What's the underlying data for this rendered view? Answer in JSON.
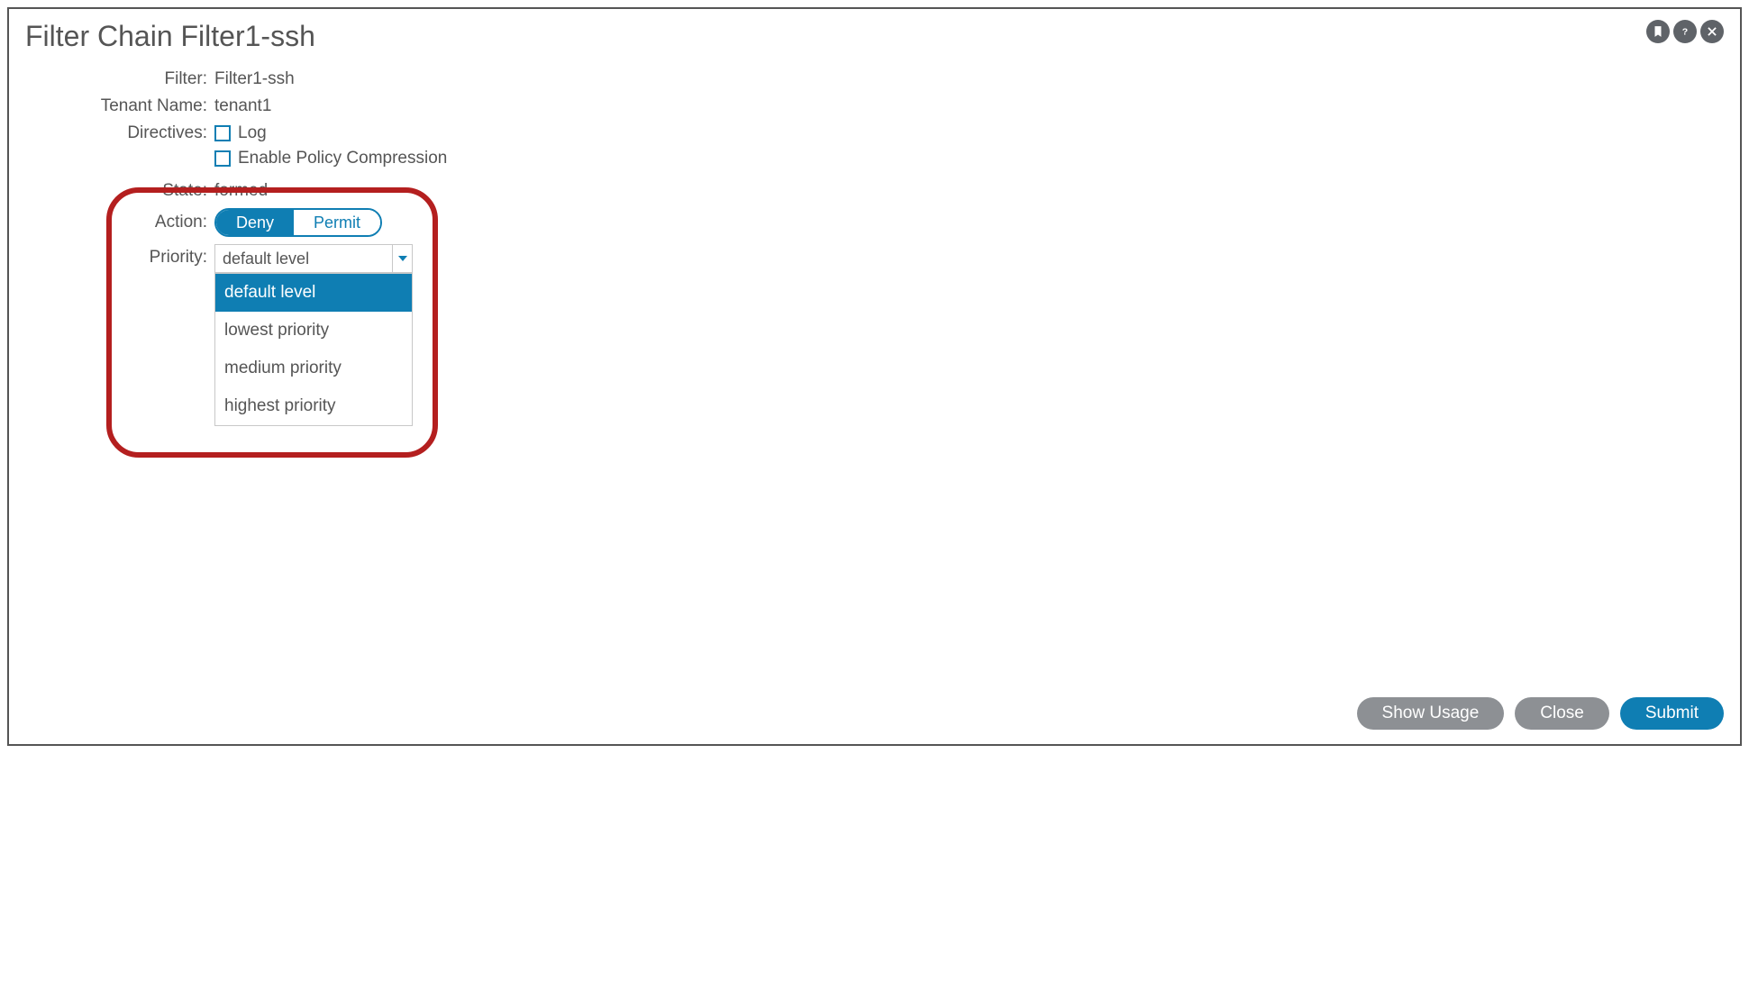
{
  "header": {
    "title_prefix": "Filter Chain ",
    "title_name": "Filter1-ssh"
  },
  "form": {
    "labels": {
      "filter": "Filter:",
      "tenant": "Tenant Name:",
      "directives": "Directives:",
      "state": "State:",
      "action": "Action:",
      "priority": "Priority:"
    },
    "values": {
      "filter": "Filter1-ssh",
      "tenant": "tenant1",
      "directive_log": "Log",
      "directive_compression": "Enable Policy Compression",
      "state": "formed",
      "priority_selected": "default level"
    },
    "action_toggle": {
      "deny": "Deny",
      "permit": "Permit",
      "active": "deny"
    },
    "priority_options": [
      "default level",
      "lowest priority",
      "medium priority",
      "highest priority"
    ]
  },
  "footer": {
    "show_usage": "Show Usage",
    "close": "Close",
    "submit": "Submit"
  }
}
